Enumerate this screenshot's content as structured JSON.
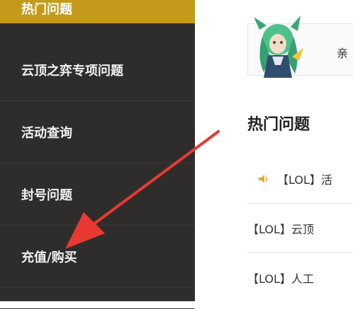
{
  "sidebar": {
    "items": [
      {
        "label": "热门问题"
      },
      {
        "label": "云顶之弈专项问题"
      },
      {
        "label": "活动查询"
      },
      {
        "label": "封号问题"
      },
      {
        "label": "充值/购买"
      },
      {
        "label": ""
      }
    ],
    "active_color": "#c49a1a",
    "bg_color": "#2f2d2b"
  },
  "main": {
    "banner": {
      "greeting": "亲"
    },
    "section_title": "热门问题",
    "questions": [
      {
        "text": "【LOL】活",
        "icon": "speaker-icon"
      },
      {
        "text": "【LOL】云顶"
      },
      {
        "text": "【LOL】人工"
      }
    ]
  },
  "annotation": {
    "color": "#e83a32"
  }
}
